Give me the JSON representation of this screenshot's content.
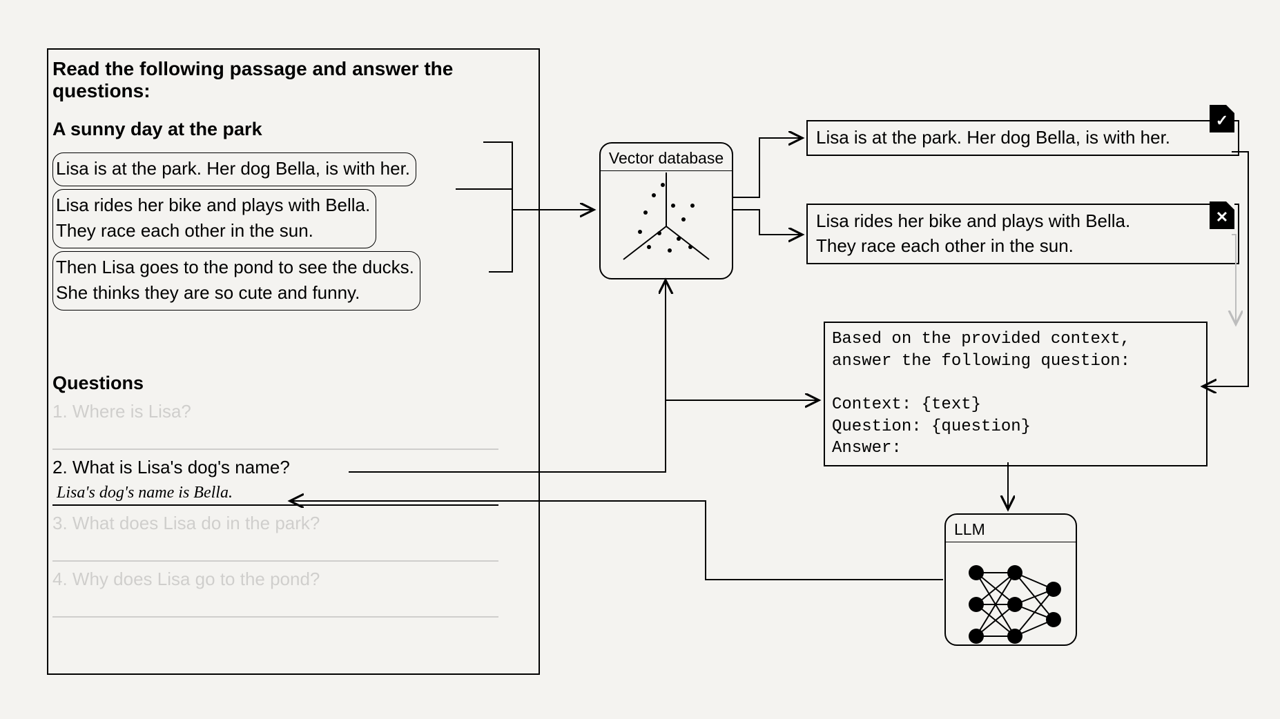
{
  "worksheet": {
    "heading": "Read the following passage and answer the questions:",
    "title": "A sunny day at the park",
    "chunks": [
      {
        "lines": [
          "Lisa is at the park. Her dog Bella, is with her."
        ]
      },
      {
        "lines": [
          "Lisa rides her bike and plays with Bella.",
          "They race each other in the sun."
        ]
      },
      {
        "lines": [
          "Then Lisa goes to the pond to see the ducks.",
          "She thinks they are so cute and funny."
        ]
      }
    ],
    "questions_label": "Questions",
    "questions": [
      {
        "num": "1.",
        "text": "Where is Lisa?",
        "faded": true,
        "answer": ""
      },
      {
        "num": "2.",
        "text": "What is Lisa's dog's name?",
        "faded": false,
        "answer": "Lisa's dog's name is Bella."
      },
      {
        "num": "3.",
        "text": "What does Lisa do in the park?",
        "faded": true,
        "answer": ""
      },
      {
        "num": "4.",
        "text": "Why does Lisa go to the pond?",
        "faded": true,
        "answer": ""
      }
    ]
  },
  "vector_db": {
    "title": "Vector database"
  },
  "retrieved": [
    {
      "lines": [
        "Lisa is at the park. Her dog Bella, is with her."
      ],
      "status": "check"
    },
    {
      "lines": [
        "Lisa rides her bike and plays with Bella.",
        "They race each other in the sun."
      ],
      "status": "x"
    }
  ],
  "prompt": {
    "line1": "Based on the provided context,",
    "line2": "answer the following question:",
    "line3": "",
    "line4": "Context: {text}",
    "line5": "Question: {question}",
    "line6": "Answer:"
  },
  "llm": {
    "title": "LLM"
  }
}
